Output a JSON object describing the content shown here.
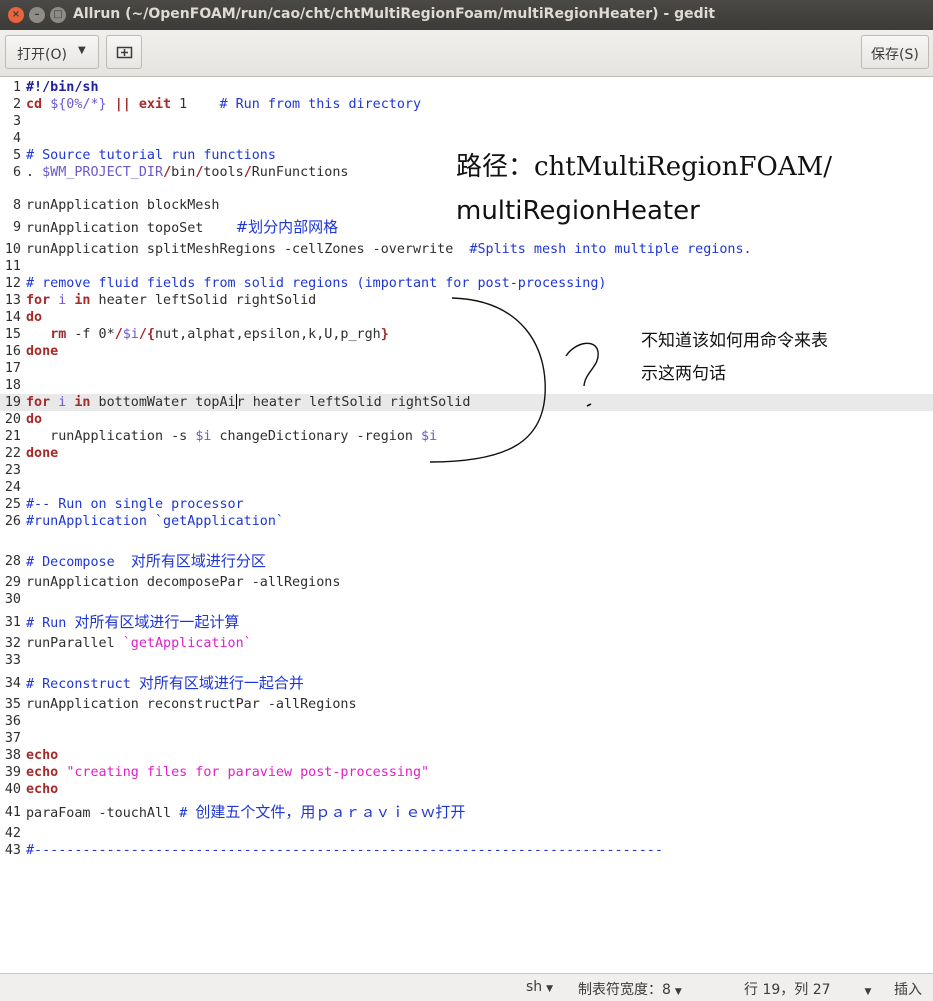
{
  "window": {
    "title": "Allrun (~/OpenFOAM/run/cao/cht/chtMultiRegionFoam/multiRegionHeater) - gedit",
    "close_glyph": "×",
    "minimize_glyph": "–",
    "maximize_glyph": "□"
  },
  "toolbar": {
    "open_label": "打开(O)",
    "save_label": "保存(S)"
  },
  "annotations": {
    "path_label_line1": "路径：chtMultiRegionFOAM/",
    "path_label_line2": "multiRegionHeater",
    "question_line1": "不知道该如何用命令来表",
    "question_line2": "示这两句话"
  },
  "status": {
    "language": "sh",
    "tab_width": "制表符宽度：8",
    "position": "行 19，列 27",
    "mode": "插入"
  },
  "colors": {
    "keyword": "#a52a2a",
    "comment": "#1f36d6",
    "variable": "#6a5acd",
    "string": "#e020c8"
  }
}
